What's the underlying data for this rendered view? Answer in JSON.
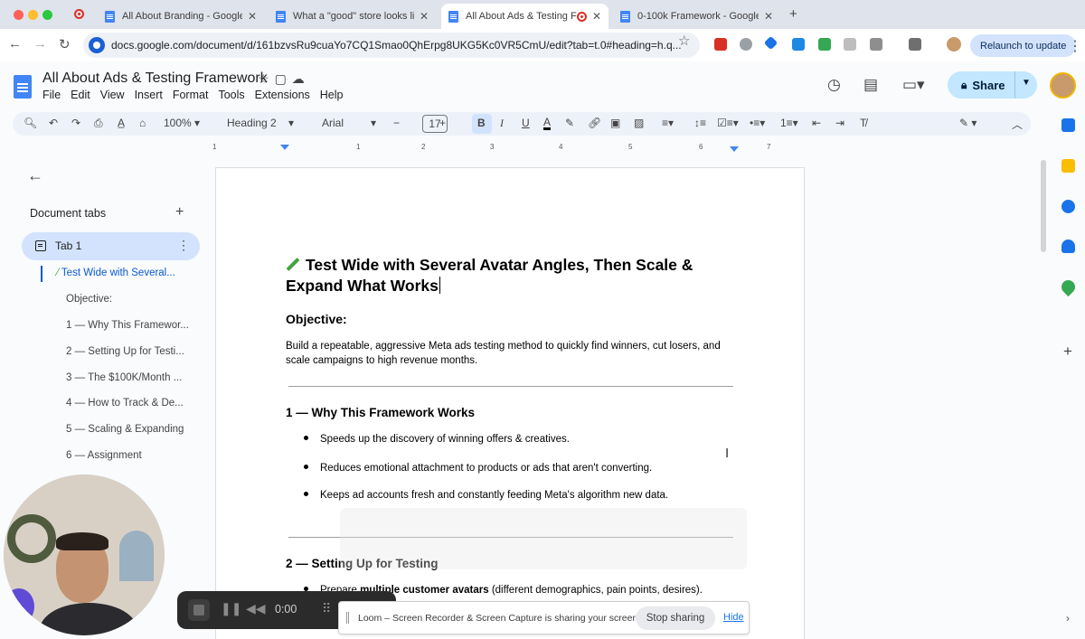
{
  "browser": {
    "tabs": [
      {
        "title": "All About Branding - Google"
      },
      {
        "title": "What a \"good\" store looks lik"
      },
      {
        "title": "All About Ads & Testing F"
      },
      {
        "title": "0-100k Framework - Google"
      }
    ],
    "url": "docs.google.com/document/d/161bzvsRu9cuaYo7CQ1Smao0QhErpg8UKG5Kc0VR5CmU/edit?tab=t.0#heading=h.q...",
    "relaunch_label": "Relaunch to update"
  },
  "docs": {
    "title": "All About Ads & Testing Framework",
    "menu": [
      "File",
      "Edit",
      "View",
      "Insert",
      "Format",
      "Tools",
      "Extensions",
      "Help"
    ],
    "share_label": "Share"
  },
  "toolbar": {
    "zoom": "100%",
    "style": "Heading 2",
    "font": "Arial",
    "font_size": "17"
  },
  "ruler": [
    "1",
    "1",
    "2",
    "3",
    "4",
    "5",
    "6",
    "7"
  ],
  "sidebar": {
    "header": "Document tabs",
    "tab_name": "Tab 1",
    "outline": [
      "Test Wide with Several...",
      "Objective:",
      "1 — Why This Framewor...",
      "2 — Setting Up for Testi...",
      "3 — The $100K/Month ...",
      "4 — How to Track & De...",
      "5 — Scaling & Expanding",
      "6 — Assignment"
    ]
  },
  "document": {
    "heading": "Test Wide with Several Avatar Angles, Then Scale & Expand What Works",
    "objective_label": "Objective:",
    "objective_text": "Build a repeatable, aggressive Meta ads testing method to quickly find winners, cut losers, and scale campaigns to high revenue months.",
    "section1_title": "1 — Why This Framework Works",
    "section1_bullets": [
      "Speeds up the discovery of winning offers & creatives.",
      "Reduces emotional attachment to products or ads that aren't converting.",
      "Keeps ad accounts fresh and constantly feeding Meta's algorithm new data."
    ],
    "section2_title": "2 — Setting Up for Testing",
    "section2_bullet_pre": "Prepare ",
    "section2_bullet_bold": "multiple customer avatars",
    "section2_bullet_post": " (different demographics, pain points, desires)."
  },
  "loom": {
    "time": "0:00",
    "share_message": "Loom – Screen Recorder & Screen Capture is sharing your screen.",
    "stop_label": "Stop sharing",
    "hide_label": "Hide"
  },
  "colors": {
    "share_button": "#c2e7ff",
    "active_outline": "#0b57d0",
    "tab_highlight": "#d3e3fd"
  }
}
